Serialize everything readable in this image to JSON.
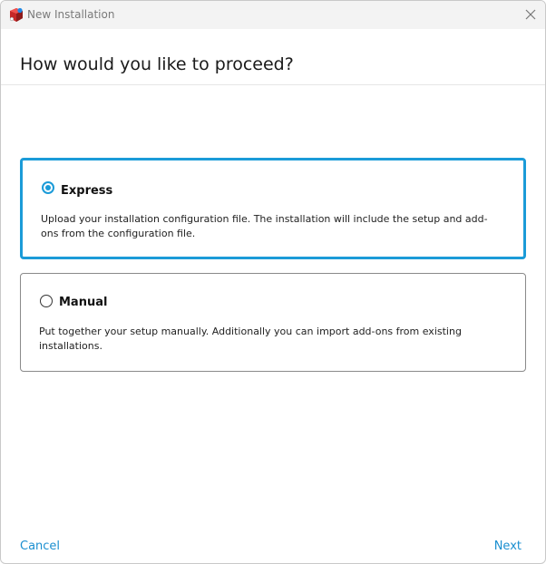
{
  "window": {
    "title": "New Installation",
    "icon": "app-cube-icon",
    "close_icon": "close-icon"
  },
  "header": {
    "heading": "How would you like to proceed?"
  },
  "options": [
    {
      "title": "Express",
      "selected": true,
      "description": "Upload your installation configuration file. The installation will include the setup and add-ons from the configuration file."
    },
    {
      "title": "Manual",
      "selected": false,
      "description": "Put together your setup manually. Additionally you can import add-ons from existing installations."
    }
  ],
  "footer": {
    "cancel_label": "Cancel",
    "next_label": "Next"
  },
  "colors": {
    "accent": "#1b9bd8",
    "link": "#1b8fd0",
    "titlebar": "#f3f3f3"
  }
}
